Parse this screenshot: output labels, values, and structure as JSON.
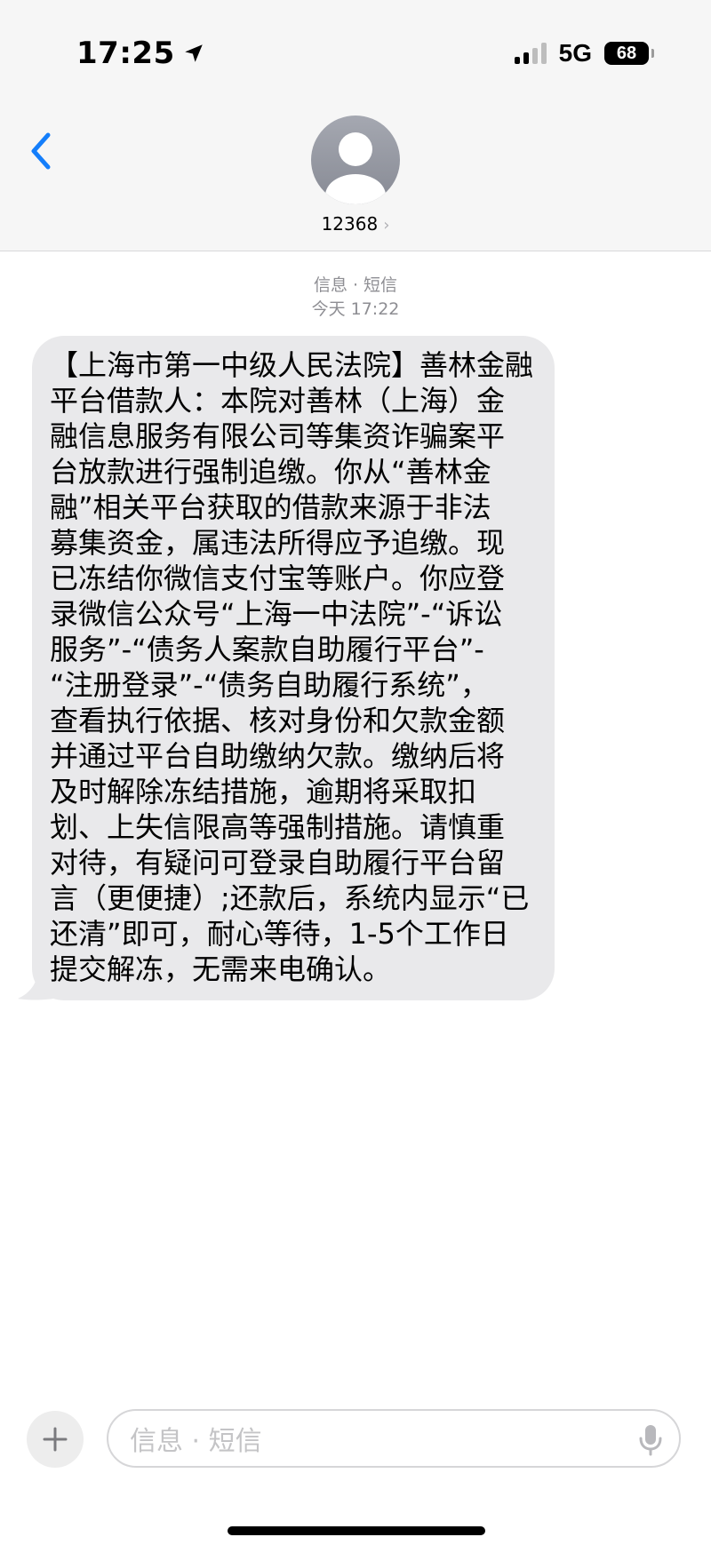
{
  "status_bar": {
    "time": "17:25",
    "network": "5G",
    "battery": "68"
  },
  "header": {
    "contact_name": "12368",
    "contact_chevron": "›",
    "back_icon": "chevron-left-icon"
  },
  "conversation": {
    "service_label": "信息 · 短信",
    "timestamp": "今天 17:22",
    "message_lines": [
      "【上海市第一中级人民法院】善林金融",
      "平台借款人：本院对善林（上海）金",
      "融信息服务有限公司等集资诈骗案平",
      "台放款进行强制追缴。你从“善林金",
      "融”相关平台获取的借款来源于非法",
      "募集资金，属违法所得应予追缴。现",
      "已冻结你微信支付宝等账户。你应登",
      "录微信公众号“上海一中法院”-“诉讼",
      "服务”-“债务人案款自助履行平台”-",
      "“注册登录”-“债务自助履行系统”，",
      "查看执行依据、核对身份和欠款金额",
      "并通过平台自助缴纳欠款。缴纳后将",
      "及时解除冻结措施，逾期将采取扣",
      "划、上失信限高等强制措施。请慎重",
      "对待，有疑问可登录自助履行平台留",
      "言（更便捷）;还款后，系统内显示“已",
      "还清”即可，耐心等待，1-5个工作日",
      "提交解冻，无需来电确认。"
    ]
  },
  "composer": {
    "placeholder": "信息 · 短信",
    "plus_icon": "plus-icon",
    "mic_icon": "microphone-icon"
  },
  "colors": {
    "accent": "#147efb",
    "bubble": "#e9e9eb",
    "meta_text": "#8e8e93"
  }
}
